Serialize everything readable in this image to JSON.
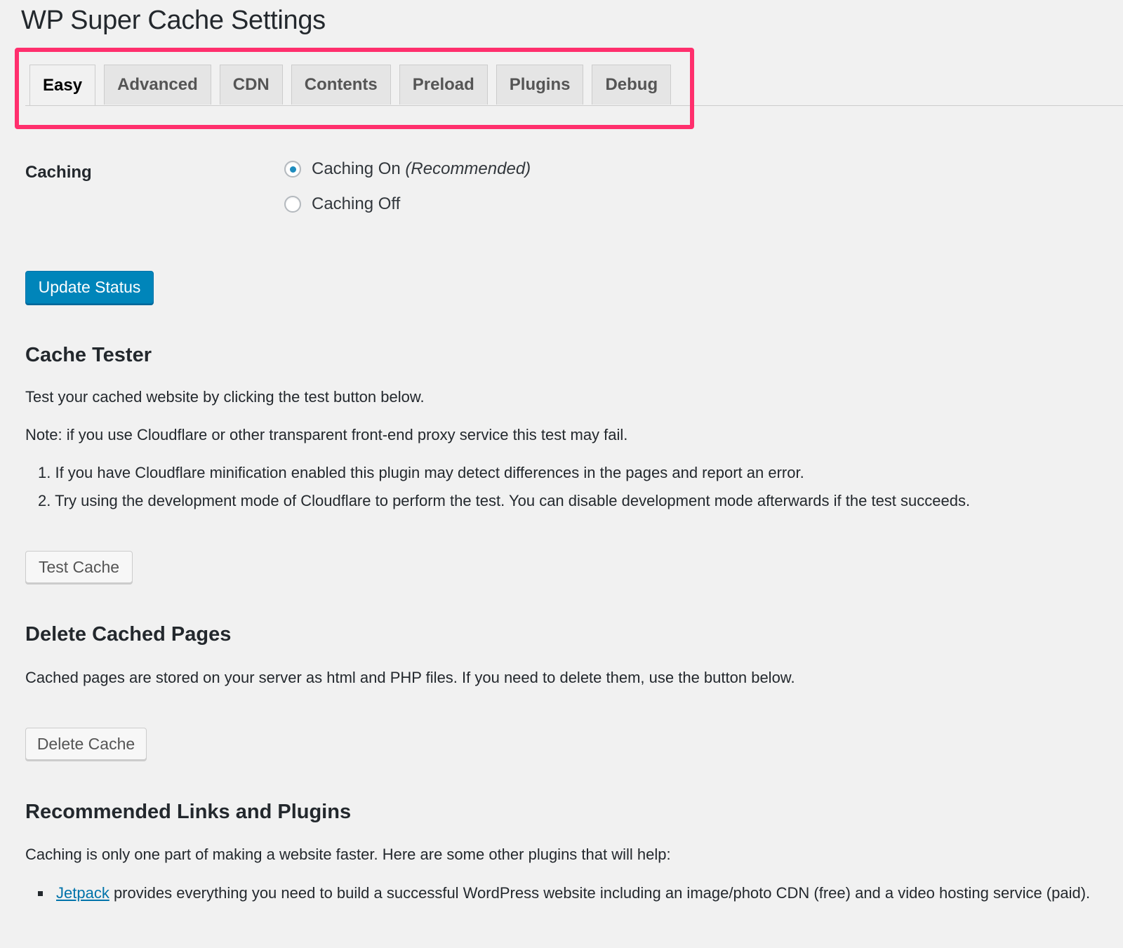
{
  "page": {
    "title": "WP Super Cache Settings"
  },
  "tabs": [
    {
      "label": "Easy",
      "active": true
    },
    {
      "label": "Advanced",
      "active": false
    },
    {
      "label": "CDN",
      "active": false
    },
    {
      "label": "Contents",
      "active": false
    },
    {
      "label": "Preload",
      "active": false
    },
    {
      "label": "Plugins",
      "active": false
    },
    {
      "label": "Debug",
      "active": false
    }
  ],
  "caching": {
    "label": "Caching",
    "options": [
      {
        "label": "Caching On",
        "note": "(Recommended)",
        "checked": true
      },
      {
        "label": "Caching Off",
        "checked": false
      }
    ],
    "update_button": "Update Status"
  },
  "cache_tester": {
    "heading": "Cache Tester",
    "intro": "Test your cached website by clicking the test button below.",
    "note": "Note: if you use Cloudflare or other transparent front-end proxy service this test may fail.",
    "steps": [
      "1. If you have Cloudflare minification enabled this plugin may detect differences in the pages and report an error.",
      "2. Try using the development mode of Cloudflare to perform the test. You can disable development mode afterwards if the test succeeds."
    ],
    "button": "Test Cache"
  },
  "delete_cached": {
    "heading": "Delete Cached Pages",
    "text": "Cached pages are stored on your server as html and PHP files. If you need to delete them, use the button below.",
    "button": "Delete Cache"
  },
  "recommended": {
    "heading": "Recommended Links and Plugins",
    "intro": "Caching is only one part of making a website faster. Here are some other plugins that will help:",
    "items": [
      {
        "link": "Jetpack",
        "text": " provides everything you need to build a successful WordPress website including an image/photo CDN (free) and a video hosting service (paid)."
      }
    ]
  },
  "colors": {
    "highlight": "#ff2f6d",
    "primary_button": "#0085ba",
    "link": "#0073aa",
    "background": "#f1f1f1"
  }
}
